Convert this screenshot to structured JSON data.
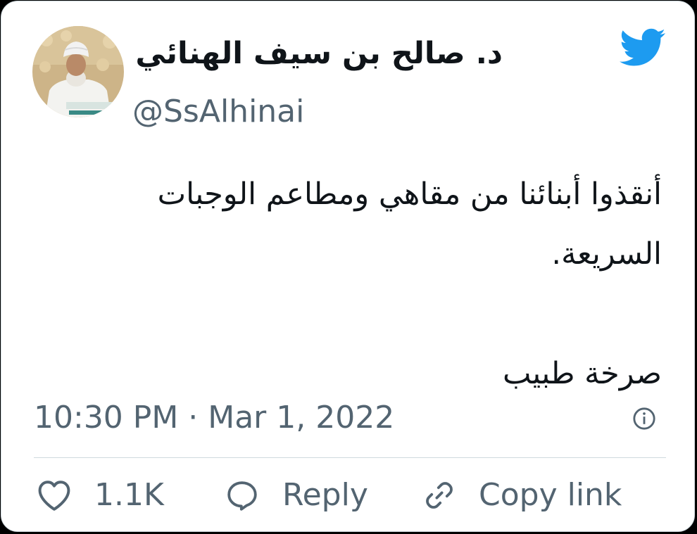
{
  "author": {
    "display_name": "د. صالح بن سيف الهنائي",
    "handle": "@SsAlhinai",
    "avatar_icon": "profile-photo"
  },
  "brand": {
    "icon": "twitter-bird-icon",
    "color": "#1d9bf0"
  },
  "tweet": {
    "text": "أنقذوا أبنائنا من مقاهي ومطاعم الوجبات السريعة.\n\nصرخة طبيب",
    "timestamp": "10:30 PM · Mar 1, 2022"
  },
  "actions": {
    "like_count": "1.1K",
    "reply_label": "Reply",
    "copy_link_label": "Copy link"
  },
  "colors": {
    "text_primary": "#0f1419",
    "text_secondary": "#536471",
    "border": "#cfd9de"
  }
}
